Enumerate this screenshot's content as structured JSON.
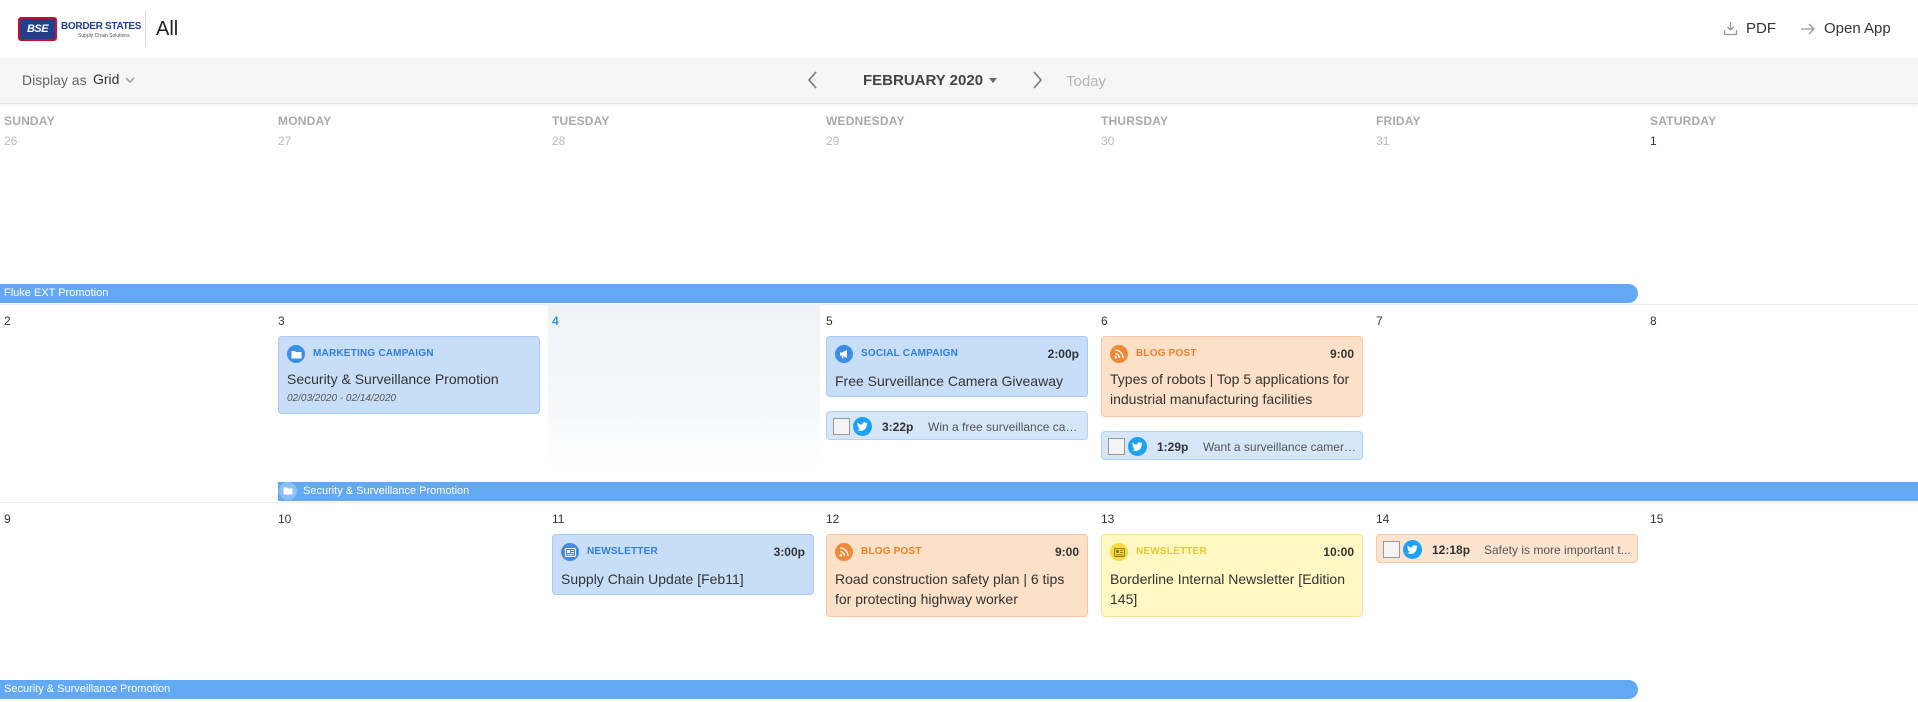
{
  "header": {
    "logo_badge": "BSE",
    "logo_name": "BORDER STATES",
    "logo_sub": "Supply Chain Solutions",
    "title": "All",
    "pdf_label": "PDF",
    "open_app_label": "Open App"
  },
  "toolbar": {
    "display_label": "Display as",
    "display_value": "Grid",
    "month": "FEBRUARY 2020",
    "today_label": "Today"
  },
  "calendar": {
    "weekdays": [
      "SUNDAY",
      "MONDAY",
      "TUESDAY",
      "WEDNESDAY",
      "THURSDAY",
      "FRIDAY",
      "SATURDAY"
    ],
    "weeks": [
      [
        "26",
        "27",
        "28",
        "29",
        "30",
        "31",
        "1"
      ],
      [
        "2",
        "3",
        "4",
        "5",
        "6",
        "7",
        "8"
      ],
      [
        "9",
        "10",
        "11",
        "12",
        "13",
        "14",
        "15"
      ]
    ],
    "today": "4",
    "bars": {
      "fluke": "Fluke EXT Promotion",
      "security_week2": "Security & Surveillance Promotion",
      "security_week3": "Security & Surveillance Promotion"
    },
    "cards": {
      "marketing": {
        "type": "MARKETING CAMPAIGN",
        "title": "Security & Surveillance Promotion",
        "dates": "02/03/2020 - 02/14/2020",
        "icon": "folder-icon"
      },
      "social": {
        "type": "SOCIAL CAMPAIGN",
        "time": "2:00p",
        "title": "Free Surveillance Camera Giveaway",
        "icon": "megaphone-icon"
      },
      "blog1": {
        "type": "BLOG POST",
        "time": "9:00",
        "title": "Types of robots | Top 5 applications for industrial manufacturing facilities",
        "icon": "rss-icon"
      },
      "newsletter1": {
        "type": "NEWSLETTER",
        "time": "3:00p",
        "title": "Supply Chain Update [Feb11]",
        "icon": "newsletter-icon"
      },
      "blog2": {
        "type": "BLOG POST",
        "time": "9:00",
        "title": "Road construction safety plan | 6 tips for protecting highway worker",
        "icon": "rss-icon"
      },
      "newsletter2": {
        "type": "NEWSLETTER",
        "time": "10:00",
        "title": "Borderline Internal Newsletter [Edition 145]",
        "icon": "newsletter-icon"
      }
    },
    "tweets": {
      "t1": {
        "time": "3:22p",
        "text": "Win a free surveillance cam..."
      },
      "t2": {
        "time": "1:29p",
        "text": "Want a surveillance camera..."
      },
      "t3": {
        "time": "12:18p",
        "text": "Safety is more important t..."
      }
    },
    "colors": {
      "bar": "#63a8f3",
      "blue_card": "#c8def8",
      "orange_card": "#fde0c8",
      "yellow_card": "#fff8c4",
      "today": "#2d9cdb",
      "twitter": "#1da1f2"
    }
  }
}
